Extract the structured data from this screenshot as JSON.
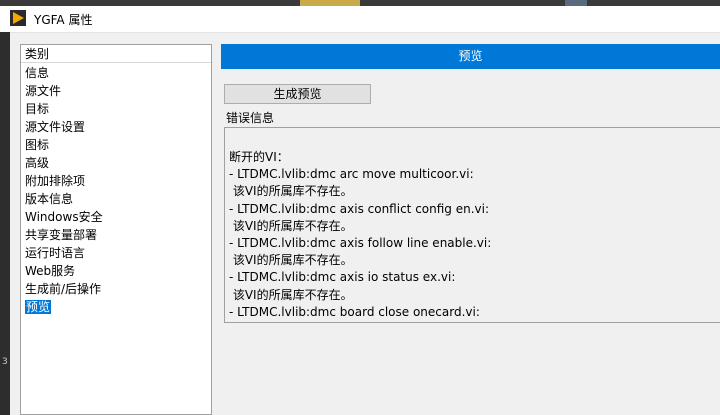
{
  "window": {
    "title": "YGFA 属性",
    "app_icon": "labview-run-arrow-icon",
    "icon_color": "#f5a800"
  },
  "categories": {
    "header": "类别",
    "items": [
      {
        "label": "信息"
      },
      {
        "label": "源文件"
      },
      {
        "label": "目标"
      },
      {
        "label": "源文件设置"
      },
      {
        "label": "图标"
      },
      {
        "label": "高级"
      },
      {
        "label": "附加排除项"
      },
      {
        "label": "版本信息"
      },
      {
        "label": "Windows安全"
      },
      {
        "label": "共享变量部署"
      },
      {
        "label": "运行时语言"
      },
      {
        "label": "Web服务"
      },
      {
        "label": "生成前/后操作"
      },
      {
        "label": "预览",
        "selected": true
      }
    ]
  },
  "panel": {
    "header": "预览",
    "generate_button": "生成预览",
    "error_label": "错误信息",
    "error_lines": [
      "断开的VI：",
      "- LTDMC.lvlib:dmc arc move multicoor.vi:",
      " 该VI的所属库不存在。",
      "- LTDMC.lvlib:dmc axis conflict config en.vi:",
      " 该VI的所属库不存在。",
      "- LTDMC.lvlib:dmc axis follow line enable.vi:",
      " 该VI的所属库不存在。",
      "- LTDMC.lvlib:dmc axis io status ex.vi:",
      " 该VI的所属库不存在。",
      "- LTDMC.lvlib:dmc board close onecard.vi:"
    ]
  },
  "colors": {
    "accent": "#0078d7",
    "selection": "#0078d7"
  }
}
